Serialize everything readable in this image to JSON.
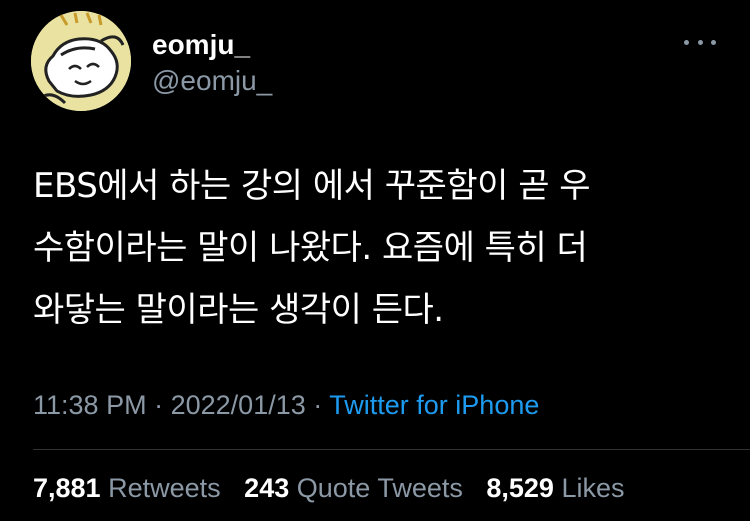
{
  "user": {
    "display_name": "eomju_",
    "handle": "@eomju_"
  },
  "tweet": {
    "lines": [
      "EBS에서 하는 강의 에서 꾸준함이 곧 우",
      "수함이라는 말이 나왔다. 요즘에 특히 더",
      "와닿는 말이라는 생각이 든다."
    ],
    "time": "11:38 PM",
    "date": "2022/01/13",
    "separator": "·",
    "source": "Twitter for iPhone"
  },
  "stats": {
    "retweets": {
      "count": "7,881",
      "label": "Retweets"
    },
    "quotes": {
      "count": "243",
      "label": "Quote Tweets"
    },
    "likes": {
      "count": "8,529",
      "label": "Likes"
    }
  },
  "icons": {
    "more": "more-horizontal-icon"
  },
  "colors": {
    "background": "#000000",
    "text": "#ffffff",
    "secondary": "#8b98a5",
    "link": "#1d9bf0",
    "avatar_bg": "#e9e2a0"
  }
}
